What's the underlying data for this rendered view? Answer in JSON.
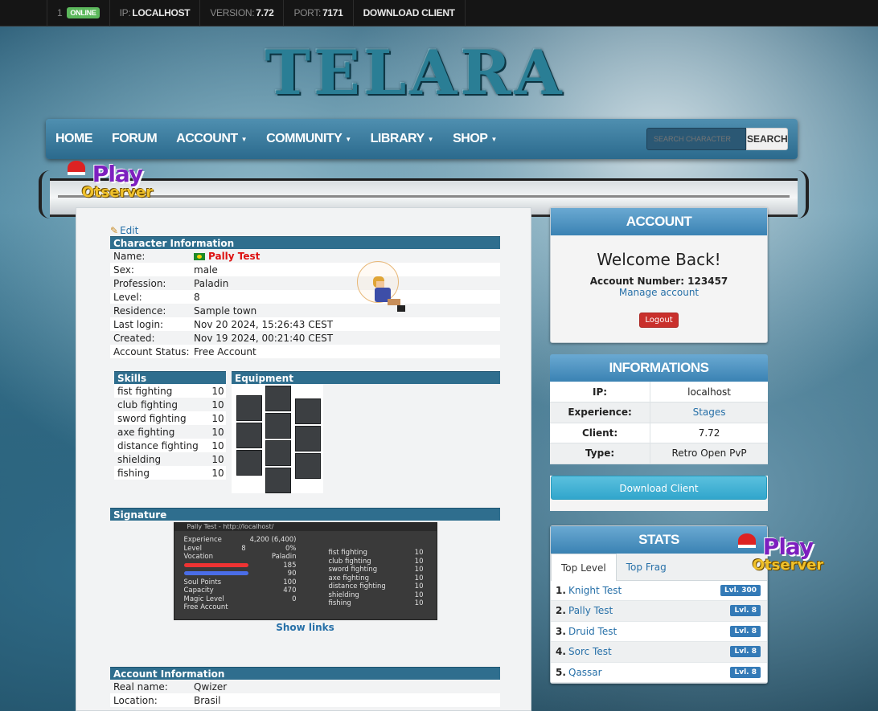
{
  "topbar": {
    "players_online": "1",
    "online_label": "ONLINE",
    "ip_label": "IP:",
    "ip_value": "LOCALHOST",
    "version_label": "VERSION:",
    "version_value": "7.72",
    "port_label": "PORT:",
    "port_value": "7171",
    "download": "DOWNLOAD CLIENT"
  },
  "logo_text": "TELARA",
  "nav": {
    "home": "HOME",
    "forum": "FORUM",
    "account": "ACCOUNT",
    "community": "COMMUNITY",
    "library": "LIBRARY",
    "shop": "SHOP",
    "search_placeholder": "SEARCH CHARACTER",
    "search_button": "SEARCH"
  },
  "watermark": {
    "play": "Play",
    "otserver": "Otserver"
  },
  "character": {
    "edit": "Edit",
    "section_title": "Character Information",
    "rows": [
      {
        "label": "Name:",
        "value": "Pally Test"
      },
      {
        "label": "Sex:",
        "value": "male"
      },
      {
        "label": "Profession:",
        "value": "Paladin"
      },
      {
        "label": "Level:",
        "value": "8"
      },
      {
        "label": "Residence:",
        "value": "Sample town"
      },
      {
        "label": "Last login:",
        "value": "Nov 20 2024, 15:26:43 CEST"
      },
      {
        "label": "Created:",
        "value": "Nov 19 2024, 00:21:40 CEST"
      },
      {
        "label": "Account Status:",
        "value": "Free Account"
      }
    ]
  },
  "skills": {
    "title": "Skills",
    "rows": [
      {
        "name": "fist fighting",
        "value": "10"
      },
      {
        "name": "club fighting",
        "value": "10"
      },
      {
        "name": "sword fighting",
        "value": "10"
      },
      {
        "name": "axe fighting",
        "value": "10"
      },
      {
        "name": "distance fighting",
        "value": "10"
      },
      {
        "name": "shielding",
        "value": "10"
      },
      {
        "name": "fishing",
        "value": "10"
      }
    ]
  },
  "equipment": {
    "title": "Equipment"
  },
  "signature": {
    "title": "Signature",
    "window_title": "Pally Test - http://localhost/",
    "experience_label": "Experience",
    "experience_value": "4,200 (6,400)",
    "level_label": "Level",
    "level_value": "8",
    "percent": "0%",
    "vocation_label": "Vocation",
    "vocation_value": "Paladin",
    "hp": "185",
    "mp": "90",
    "soul_label": "Soul Points",
    "soul_value": "100",
    "capacity_label": "Capacity",
    "capacity_value": "470",
    "magic_label": "Magic Level",
    "magic_value": "0",
    "status": "Free Account",
    "skills": [
      {
        "name": "fist fighting",
        "value": "10"
      },
      {
        "name": "club fighting",
        "value": "10"
      },
      {
        "name": "sword fighting",
        "value": "10"
      },
      {
        "name": "axe fighting",
        "value": "10"
      },
      {
        "name": "distance fighting",
        "value": "10"
      },
      {
        "name": "shielding",
        "value": "10"
      },
      {
        "name": "fishing",
        "value": "10"
      }
    ],
    "show_links": "Show links"
  },
  "account_info": {
    "title": "Account Information",
    "rows": [
      {
        "label": "Real name:",
        "value": "Qwizer"
      },
      {
        "label": "Location:",
        "value": "Brasil"
      }
    ]
  },
  "account_box": {
    "title": "ACCOUNT",
    "welcome": "Welcome Back!",
    "account_number": "Account Number: 123457",
    "manage": "Manage account",
    "logout": "Logout"
  },
  "informations": {
    "title": "INFORMATIONS",
    "rows": [
      {
        "label": "IP:",
        "value": "localhost"
      },
      {
        "label": "Experience:",
        "value": "Stages"
      },
      {
        "label": "Client:",
        "value": "7.72"
      },
      {
        "label": "Type:",
        "value": "Retro Open PvP"
      }
    ],
    "download": "Download Client"
  },
  "stats": {
    "title": "STATS",
    "tab_level": "Top Level",
    "tab_frag": "Top Frag",
    "rows": [
      {
        "rank": "1.",
        "name": "Knight Test",
        "level": "Lvl. 300"
      },
      {
        "rank": "2.",
        "name": "Pally Test",
        "level": "Lvl. 8"
      },
      {
        "rank": "3.",
        "name": "Druid Test",
        "level": "Lvl. 8"
      },
      {
        "rank": "4.",
        "name": "Sorc Test",
        "level": "Lvl. 8"
      },
      {
        "rank": "5.",
        "name": "Qassar",
        "level": "Lvl. 8"
      }
    ]
  },
  "colors": {
    "nav_blue": "#3a82b3",
    "section_head": "#2f6e8e",
    "link": "#2770a8",
    "online_green": "#5cb85c",
    "logout_red": "#c9302c",
    "level_badge": "#337ab7"
  }
}
